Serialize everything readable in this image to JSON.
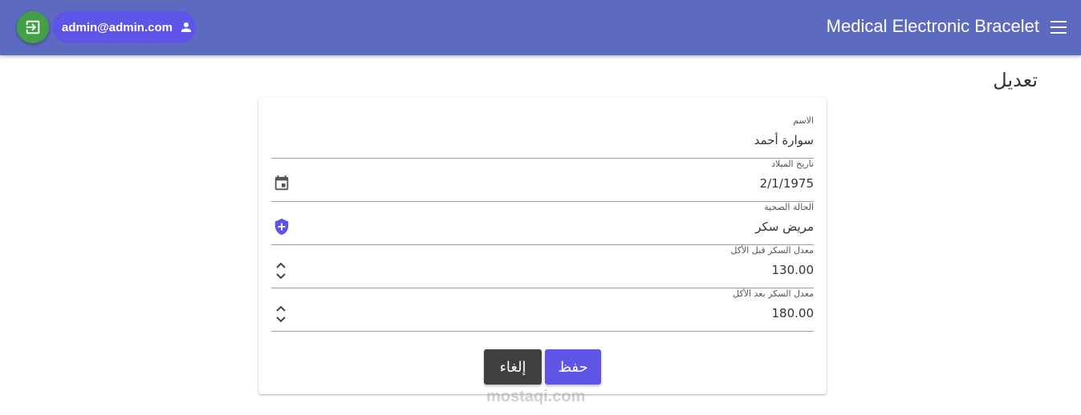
{
  "header": {
    "app_title": "Medical Electronic Bracelet",
    "user_email": "admin@admin.com",
    "logout_icon": "logout-icon",
    "user_icon": "person-icon",
    "menu_icon": "menu-icon",
    "colors": {
      "bar": "#5c6bc0",
      "logout": "#43a047",
      "chip": "#5e54e8"
    }
  },
  "page": {
    "title": "تعديل"
  },
  "form": {
    "fields": [
      {
        "label": "الاسم",
        "value": "سوارة أحمد"
      },
      {
        "label": "تاريخ الميلاد",
        "value": "2/1/1975",
        "icon": "calendar-icon"
      },
      {
        "label": "الحالة الصحية",
        "value": "مريض سكر",
        "icon": "health-shield-icon"
      },
      {
        "label": "معدل السكر قبل الأكل",
        "value": "130.00",
        "icon": "stepper-icon"
      },
      {
        "label": "معدل السكر بعد الأكل",
        "value": "180.00",
        "icon": "stepper-icon"
      }
    ],
    "cancel_label": "إلغاء",
    "save_label": "حفظ"
  },
  "watermark": "mostaqi.com"
}
